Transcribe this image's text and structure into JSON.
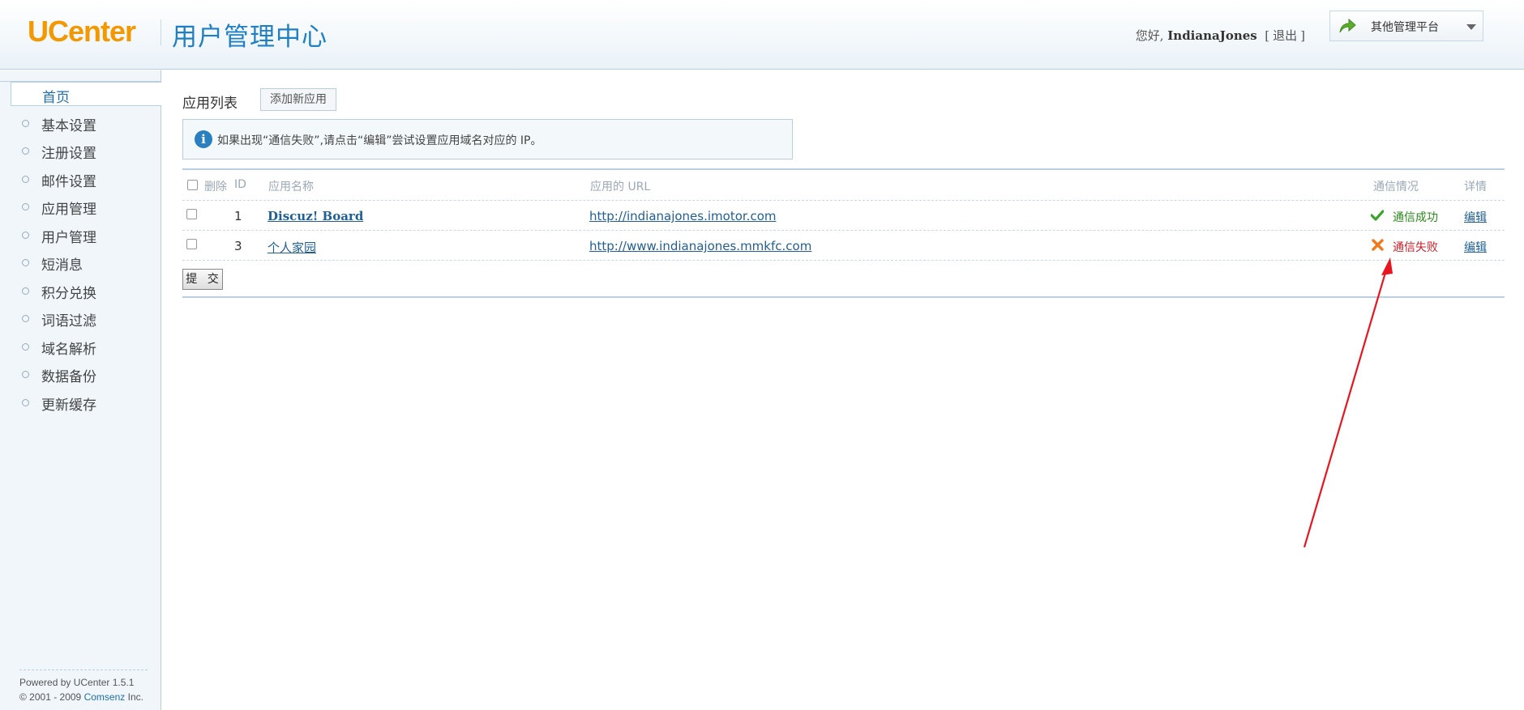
{
  "header": {
    "logo_text": "UCenter",
    "site_title": "用户管理中心",
    "greeting_prefix": "您好,",
    "username": "IndianaJones",
    "logout_open": "[",
    "logout_label": "退出",
    "logout_close": "]",
    "platform_label": "其他管理平台"
  },
  "sidebar": {
    "home_label": "首页",
    "items": [
      {
        "label": "基本设置"
      },
      {
        "label": "注册设置"
      },
      {
        "label": "邮件设置"
      },
      {
        "label": "应用管理"
      },
      {
        "label": "用户管理"
      },
      {
        "label": "短消息"
      },
      {
        "label": "积分兑换"
      },
      {
        "label": "词语过滤"
      },
      {
        "label": "域名解析"
      },
      {
        "label": "数据备份"
      },
      {
        "label": "更新缓存"
      }
    ],
    "footer_line1": "Powered by UCenter 1.5.1",
    "footer_line2_prefix": "© 2001 - 2009",
    "footer_brand": "Comsenz",
    "footer_line2_suffix": "Inc."
  },
  "main": {
    "section_title": "应用列表",
    "add_button_label": "添加新应用",
    "notice": "如果出现“通信失败”,请点击“编辑”尝试设置应用域名对应的 IP。",
    "table": {
      "columns": {
        "delete": "删除",
        "id": "ID",
        "name": "应用名称",
        "url": "应用的 URL",
        "status": "通信情况",
        "detail": "详情"
      },
      "rows": [
        {
          "id": "1",
          "name": "Discuz! Board",
          "url": "http://indianajones.imotor.com",
          "status": "通信成功",
          "status_type": "success",
          "edit": "编辑"
        },
        {
          "id": "3",
          "name": "个人家园",
          "url": "http://www.indianajones.mmkfc.com",
          "status": "通信失败",
          "status_type": "failure",
          "edit": "编辑"
        }
      ]
    },
    "submit_label": "提 交"
  },
  "colors": {
    "logo_orange": "#f39800",
    "title_blue": "#1f7fc4",
    "success_green": "#2b8a1e",
    "failure_red": "#c8202a",
    "annotation_arrow": "#e8141e"
  }
}
